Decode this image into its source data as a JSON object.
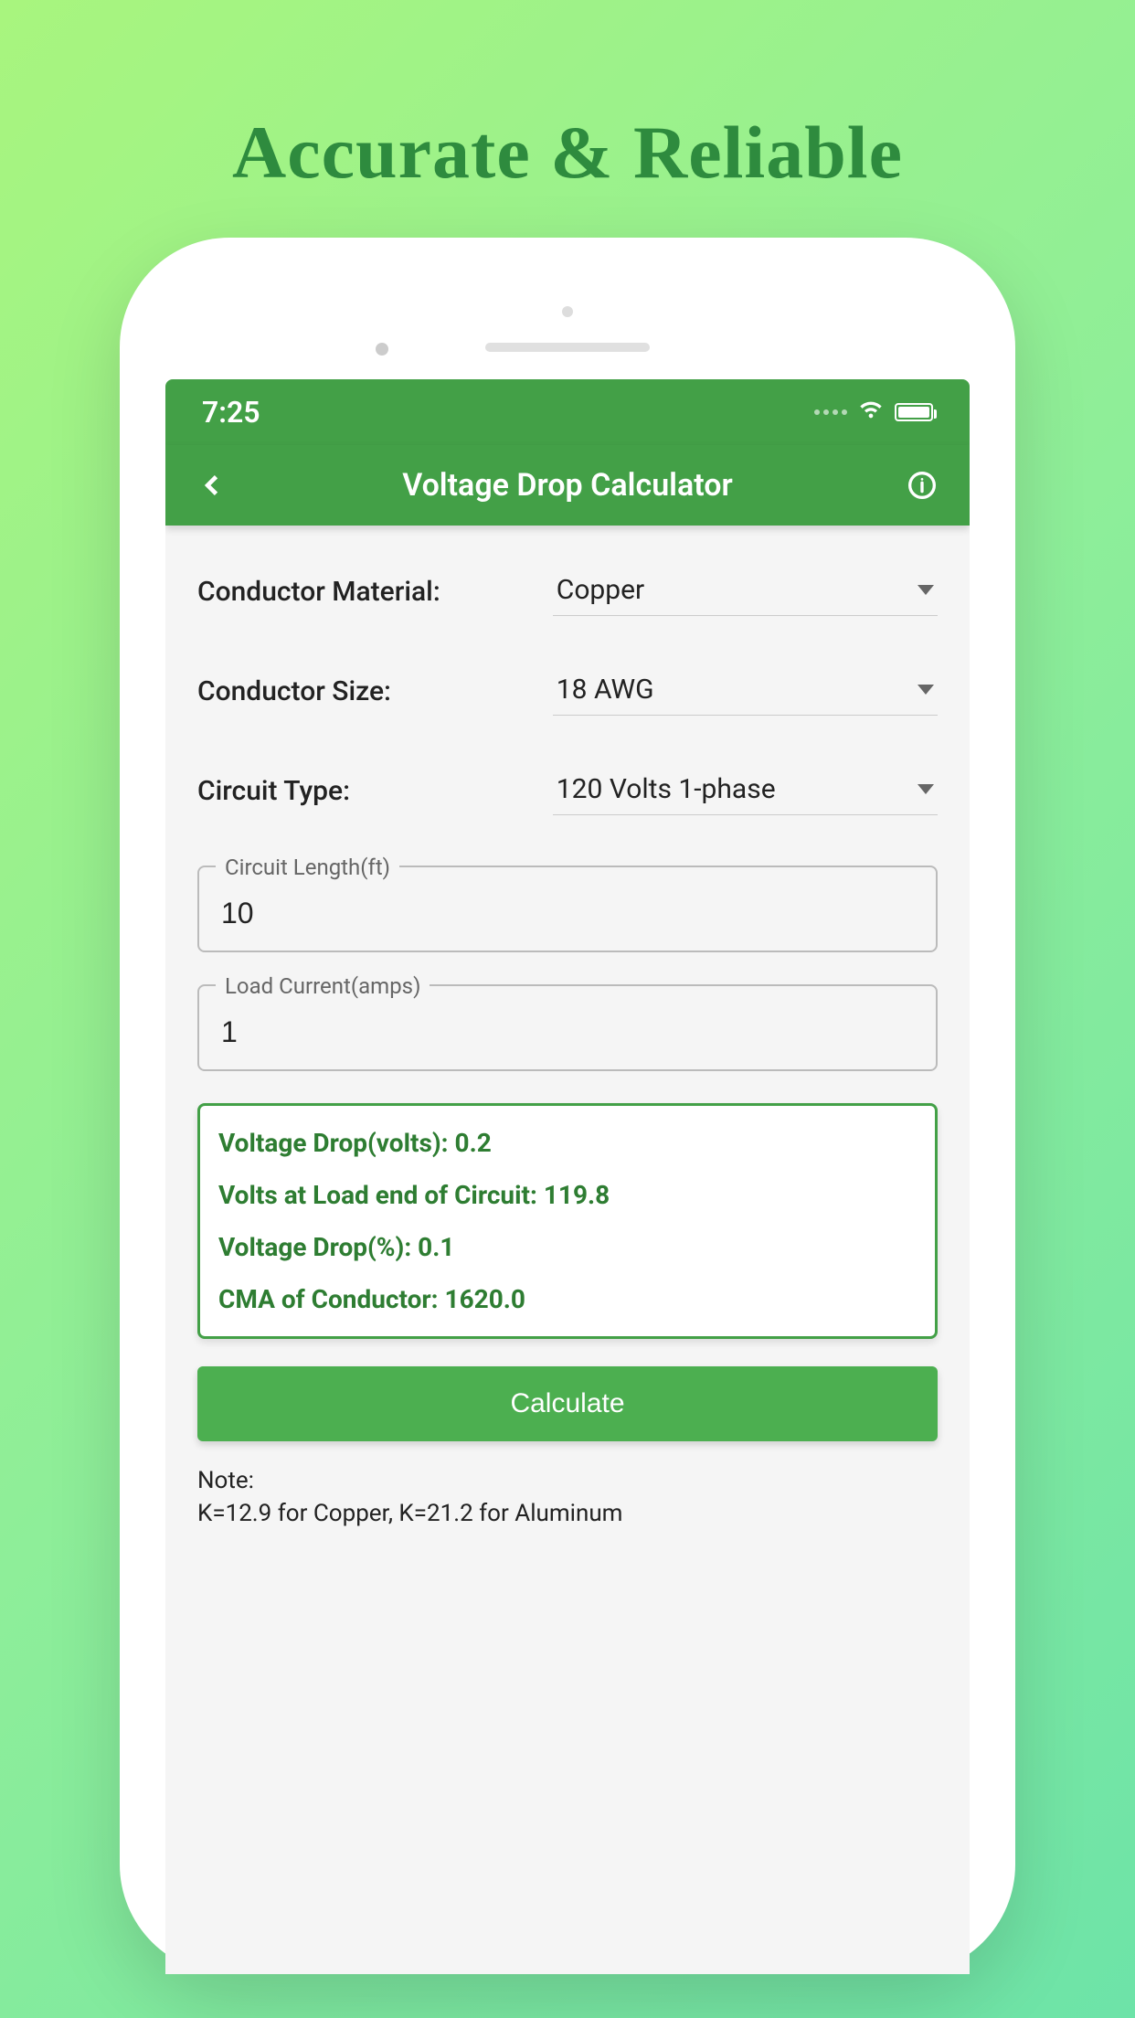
{
  "hero": {
    "title": "Accurate & Reliable"
  },
  "statusbar": {
    "time": "7:25"
  },
  "appbar": {
    "title": "Voltage Drop Calculator"
  },
  "form": {
    "material": {
      "label": "Conductor Material:",
      "value": "Copper"
    },
    "size": {
      "label": "Conductor Size:",
      "value": "18 AWG"
    },
    "circuit": {
      "label": "Circuit Type:",
      "value": "120 Volts 1-phase"
    },
    "length": {
      "legend": "Circuit Length(ft)",
      "value": "10"
    },
    "current": {
      "legend": "Load Current(amps)",
      "value": "1"
    }
  },
  "results": {
    "drop": "Voltage Drop(volts): 0.2",
    "loadend": "Volts at Load end of Circuit: 119.8",
    "percent": "Voltage Drop(%): 0.1",
    "cma": "CMA of Conductor: 1620.0"
  },
  "button": {
    "calculate": "Calculate"
  },
  "note": {
    "line1": "Note:",
    "line2": "K=12.9 for Copper, K=21.2 for Aluminum"
  }
}
